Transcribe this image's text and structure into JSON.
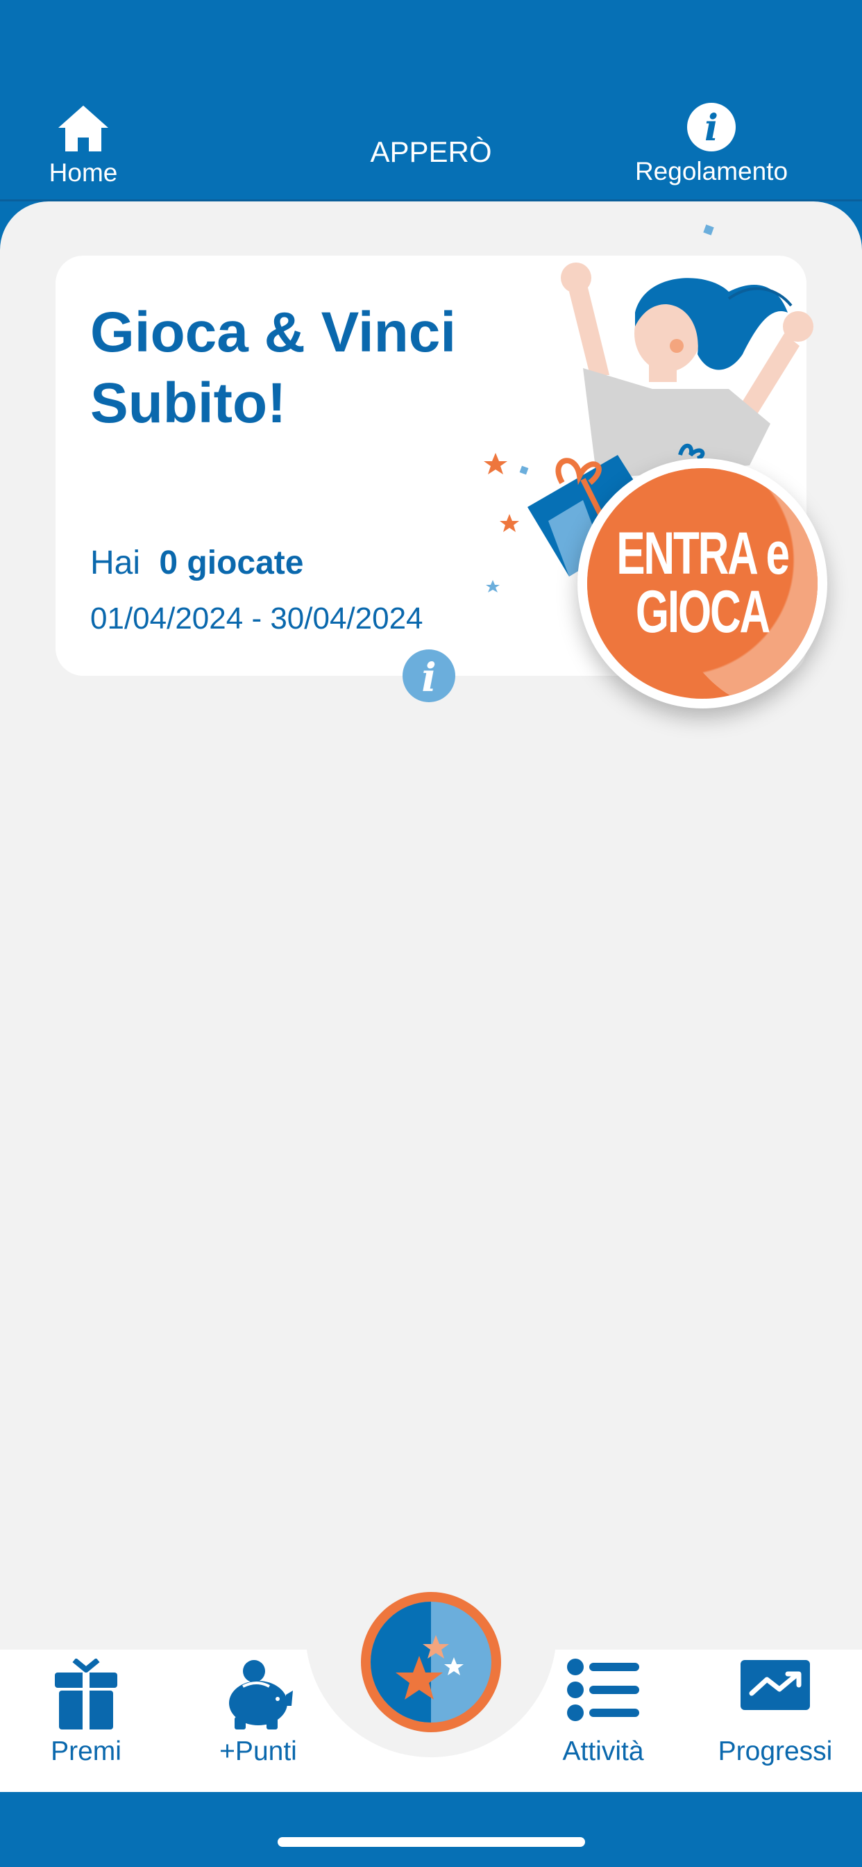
{
  "header": {
    "title": "APPERÒ",
    "home_label": "Home",
    "rules_label": "Regolamento",
    "rules_icon_glyph": "i"
  },
  "card": {
    "title": "Gioca & Vinci Subito!",
    "plays_prefix": "Hai",
    "plays_count": "0 giocate",
    "date_range": "01/04/2024 - 30/04/2024",
    "info_glyph": "i",
    "play_button_line1": "ENTRA e",
    "play_button_line2": "GIOCA"
  },
  "tabs": [
    {
      "label": "Premi",
      "icon": "gift-icon"
    },
    {
      "label": "+Punti",
      "icon": "piggy-bank-icon"
    },
    {
      "label": "",
      "icon": "stars-icon"
    },
    {
      "label": "Attività",
      "icon": "list-icon"
    },
    {
      "label": "Progressi",
      "icon": "trend-chart-icon"
    }
  ],
  "colors": {
    "brand_blue": "#0670b5",
    "light_blue": "#6baedc",
    "accent_orange": "#ee763d",
    "background": "#f2f2f2"
  }
}
